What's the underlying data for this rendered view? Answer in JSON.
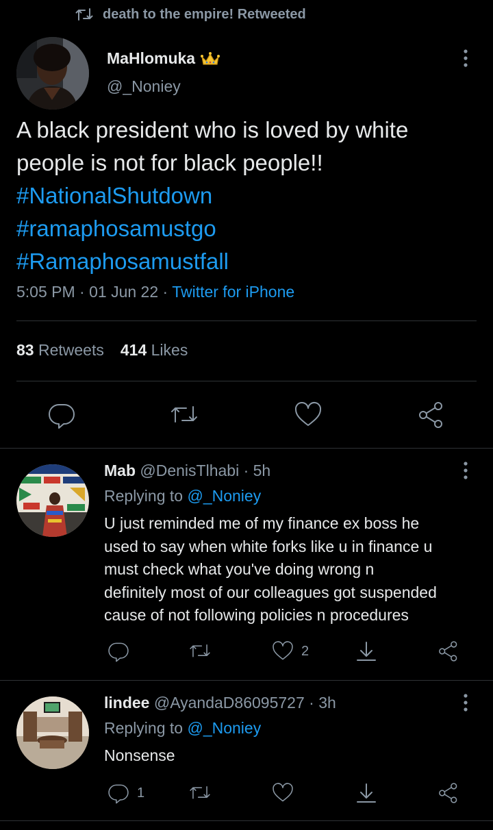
{
  "retweet_banner": {
    "text": "death to the empire! Retweeted",
    "icon": "retweet-icon"
  },
  "main_tweet": {
    "author_name": "MaHlomuka",
    "author_badge": "crown-emoji",
    "author_handle": "@_Noniey",
    "text_lines": [
      "A black president who is loved by white",
      "people is not for black people!!"
    ],
    "hashtags": [
      "#NationalShutdown",
      "#ramaphosamustgo",
      "#Ramaphosamustfall"
    ],
    "time": "5:05 PM",
    "date": "01 Jun 22",
    "separator": "·",
    "client": "Twitter for iPhone",
    "retweets_count": "83",
    "retweets_label": "Retweets",
    "likes_count": "414",
    "likes_label": "Likes",
    "actions": [
      "reply-icon",
      "retweet-icon",
      "like-icon",
      "share-icon"
    ]
  },
  "replies": [
    {
      "name": "Mab",
      "handle": "@DenisTlhabi",
      "time": "· 5h",
      "replying_label": "Replying to",
      "replying_handle": "@_Noniey",
      "text_lines": [
        "U just reminded me of my finance ex boss he",
        "used to say when white forks like u in finance u",
        "must check what you've doing wrong n",
        "definitely most of our colleagues got suspended",
        "cause of not following policies n procedures"
      ],
      "reply_count": "",
      "retweet_count": "",
      "like_count": "2"
    },
    {
      "name": "lindee",
      "handle": "@AyandaD86095727",
      "time": "· 3h",
      "replying_label": "Replying to",
      "replying_handle": "@_Noniey",
      "text_lines": [
        "Nonsense"
      ],
      "reply_count": "1",
      "retweet_count": "",
      "like_count": ""
    }
  ],
  "colors": {
    "background": "#000000",
    "text": "#e7e9ea",
    "muted": "#8b98a5",
    "link": "#1d9bf0",
    "divider": "#2f3336"
  }
}
